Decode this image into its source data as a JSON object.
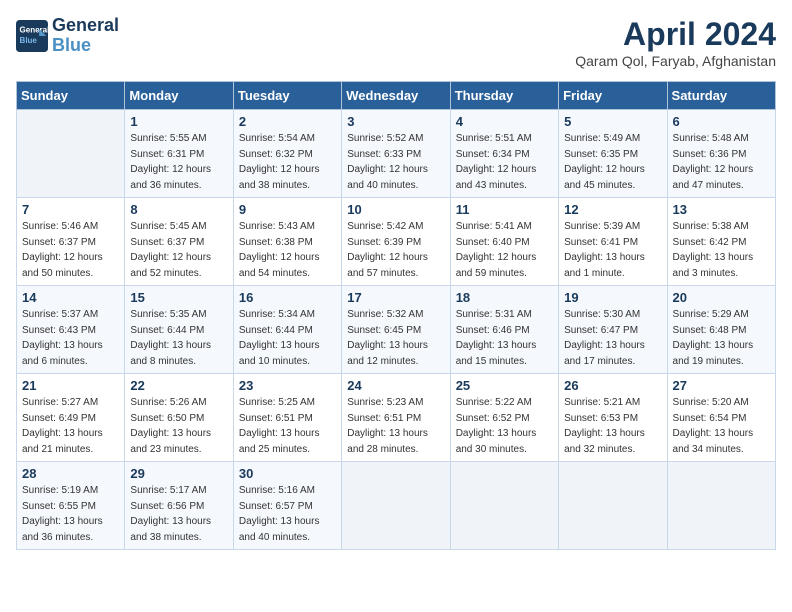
{
  "header": {
    "logo_line1": "General",
    "logo_line2": "Blue",
    "title": "April 2024",
    "subtitle": "Qaram Qol, Faryab, Afghanistan"
  },
  "weekdays": [
    "Sunday",
    "Monday",
    "Tuesday",
    "Wednesday",
    "Thursday",
    "Friday",
    "Saturday"
  ],
  "weeks": [
    [
      {
        "day": "",
        "detail": ""
      },
      {
        "day": "1",
        "detail": "Sunrise: 5:55 AM\nSunset: 6:31 PM\nDaylight: 12 hours\nand 36 minutes."
      },
      {
        "day": "2",
        "detail": "Sunrise: 5:54 AM\nSunset: 6:32 PM\nDaylight: 12 hours\nand 38 minutes."
      },
      {
        "day": "3",
        "detail": "Sunrise: 5:52 AM\nSunset: 6:33 PM\nDaylight: 12 hours\nand 40 minutes."
      },
      {
        "day": "4",
        "detail": "Sunrise: 5:51 AM\nSunset: 6:34 PM\nDaylight: 12 hours\nand 43 minutes."
      },
      {
        "day": "5",
        "detail": "Sunrise: 5:49 AM\nSunset: 6:35 PM\nDaylight: 12 hours\nand 45 minutes."
      },
      {
        "day": "6",
        "detail": "Sunrise: 5:48 AM\nSunset: 6:36 PM\nDaylight: 12 hours\nand 47 minutes."
      }
    ],
    [
      {
        "day": "7",
        "detail": "Sunrise: 5:46 AM\nSunset: 6:37 PM\nDaylight: 12 hours\nand 50 minutes."
      },
      {
        "day": "8",
        "detail": "Sunrise: 5:45 AM\nSunset: 6:37 PM\nDaylight: 12 hours\nand 52 minutes."
      },
      {
        "day": "9",
        "detail": "Sunrise: 5:43 AM\nSunset: 6:38 PM\nDaylight: 12 hours\nand 54 minutes."
      },
      {
        "day": "10",
        "detail": "Sunrise: 5:42 AM\nSunset: 6:39 PM\nDaylight: 12 hours\nand 57 minutes."
      },
      {
        "day": "11",
        "detail": "Sunrise: 5:41 AM\nSunset: 6:40 PM\nDaylight: 12 hours\nand 59 minutes."
      },
      {
        "day": "12",
        "detail": "Sunrise: 5:39 AM\nSunset: 6:41 PM\nDaylight: 13 hours\nand 1 minute."
      },
      {
        "day": "13",
        "detail": "Sunrise: 5:38 AM\nSunset: 6:42 PM\nDaylight: 13 hours\nand 3 minutes."
      }
    ],
    [
      {
        "day": "14",
        "detail": "Sunrise: 5:37 AM\nSunset: 6:43 PM\nDaylight: 13 hours\nand 6 minutes."
      },
      {
        "day": "15",
        "detail": "Sunrise: 5:35 AM\nSunset: 6:44 PM\nDaylight: 13 hours\nand 8 minutes."
      },
      {
        "day": "16",
        "detail": "Sunrise: 5:34 AM\nSunset: 6:44 PM\nDaylight: 13 hours\nand 10 minutes."
      },
      {
        "day": "17",
        "detail": "Sunrise: 5:32 AM\nSunset: 6:45 PM\nDaylight: 13 hours\nand 12 minutes."
      },
      {
        "day": "18",
        "detail": "Sunrise: 5:31 AM\nSunset: 6:46 PM\nDaylight: 13 hours\nand 15 minutes."
      },
      {
        "day": "19",
        "detail": "Sunrise: 5:30 AM\nSunset: 6:47 PM\nDaylight: 13 hours\nand 17 minutes."
      },
      {
        "day": "20",
        "detail": "Sunrise: 5:29 AM\nSunset: 6:48 PM\nDaylight: 13 hours\nand 19 minutes."
      }
    ],
    [
      {
        "day": "21",
        "detail": "Sunrise: 5:27 AM\nSunset: 6:49 PM\nDaylight: 13 hours\nand 21 minutes."
      },
      {
        "day": "22",
        "detail": "Sunrise: 5:26 AM\nSunset: 6:50 PM\nDaylight: 13 hours\nand 23 minutes."
      },
      {
        "day": "23",
        "detail": "Sunrise: 5:25 AM\nSunset: 6:51 PM\nDaylight: 13 hours\nand 25 minutes."
      },
      {
        "day": "24",
        "detail": "Sunrise: 5:23 AM\nSunset: 6:51 PM\nDaylight: 13 hours\nand 28 minutes."
      },
      {
        "day": "25",
        "detail": "Sunrise: 5:22 AM\nSunset: 6:52 PM\nDaylight: 13 hours\nand 30 minutes."
      },
      {
        "day": "26",
        "detail": "Sunrise: 5:21 AM\nSunset: 6:53 PM\nDaylight: 13 hours\nand 32 minutes."
      },
      {
        "day": "27",
        "detail": "Sunrise: 5:20 AM\nSunset: 6:54 PM\nDaylight: 13 hours\nand 34 minutes."
      }
    ],
    [
      {
        "day": "28",
        "detail": "Sunrise: 5:19 AM\nSunset: 6:55 PM\nDaylight: 13 hours\nand 36 minutes."
      },
      {
        "day": "29",
        "detail": "Sunrise: 5:17 AM\nSunset: 6:56 PM\nDaylight: 13 hours\nand 38 minutes."
      },
      {
        "day": "30",
        "detail": "Sunrise: 5:16 AM\nSunset: 6:57 PM\nDaylight: 13 hours\nand 40 minutes."
      },
      {
        "day": "",
        "detail": ""
      },
      {
        "day": "",
        "detail": ""
      },
      {
        "day": "",
        "detail": ""
      },
      {
        "day": "",
        "detail": ""
      }
    ]
  ]
}
